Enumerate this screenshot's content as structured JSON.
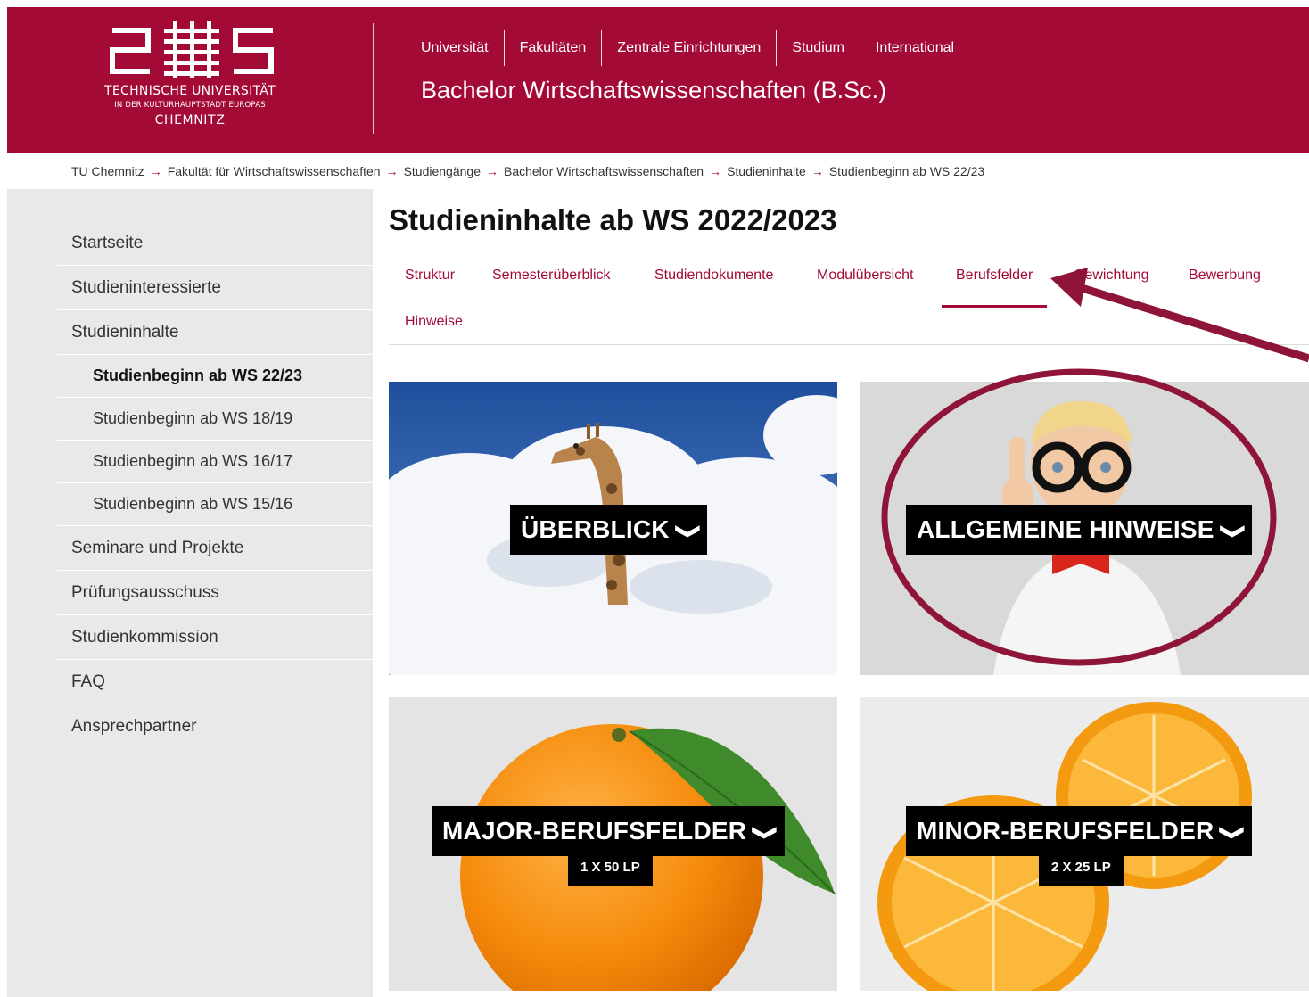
{
  "header": {
    "logo": {
      "line1": "TECHNISCHE UNIVERSITÄT",
      "line2": "IN DER KULTURHAUPTSTADT EUROPAS",
      "line3": "CHEMNITZ"
    },
    "nav": [
      "Universität",
      "Fakultäten",
      "Zentrale Einrichtungen",
      "Studium",
      "International"
    ],
    "site_title": "Bachelor Wirtschaftswissenschaften (B.Sc.)"
  },
  "breadcrumb": [
    "TU Chemnitz",
    "Fakultät für Wirtschaftswissenschaften",
    "Studiengänge",
    "Bachelor Wirtschaftswissenschaften",
    "Studieninhalte",
    "Studienbeginn ab WS 22/23"
  ],
  "breadcrumb_separator": "→",
  "sidebar": {
    "items": [
      {
        "label": "Startseite"
      },
      {
        "label": "Studieninteressierte"
      },
      {
        "label": "Studieninhalte"
      },
      {
        "label": "Studienbeginn ab WS 22/23"
      },
      {
        "label": "Studienbeginn ab WS 18/19"
      },
      {
        "label": "Studienbeginn ab WS 16/17"
      },
      {
        "label": "Studienbeginn ab WS 15/16"
      },
      {
        "label": "Seminare und Projekte"
      },
      {
        "label": "Prüfungsausschuss"
      },
      {
        "label": "Studienkommission"
      },
      {
        "label": "FAQ"
      },
      {
        "label": "Ansprechpartner"
      }
    ]
  },
  "main": {
    "title": "Studieninhalte ab WS 2022/2023",
    "tabs": [
      "Struktur",
      "Semesterüberblick",
      "Studiendokumente",
      "Modulübersicht",
      "Berufsfelder",
      "Gewichtung",
      "Bewerbung",
      "Hinweise"
    ],
    "active_tab": "Berufsfelder",
    "tiles": [
      {
        "label": "ÜBERBLICK",
        "sub": ""
      },
      {
        "label": "ALLGEMEINE HINWEISE",
        "sub": ""
      },
      {
        "label": "MAJOR-BERUFSFELDER",
        "sub": "1 X 50 LP"
      },
      {
        "label": "MINOR-BERUFSFELDER",
        "sub": "2 X 25 LP"
      }
    ]
  },
  "icons": {
    "chevron": "chevron-down-icon",
    "breadcrumb_arrow": "arrow-right-icon"
  },
  "colors": {
    "brand": "#a30a36",
    "sidebar_bg": "#e9e9e9",
    "label_bg": "#000000",
    "annotation": "#8e1538"
  }
}
